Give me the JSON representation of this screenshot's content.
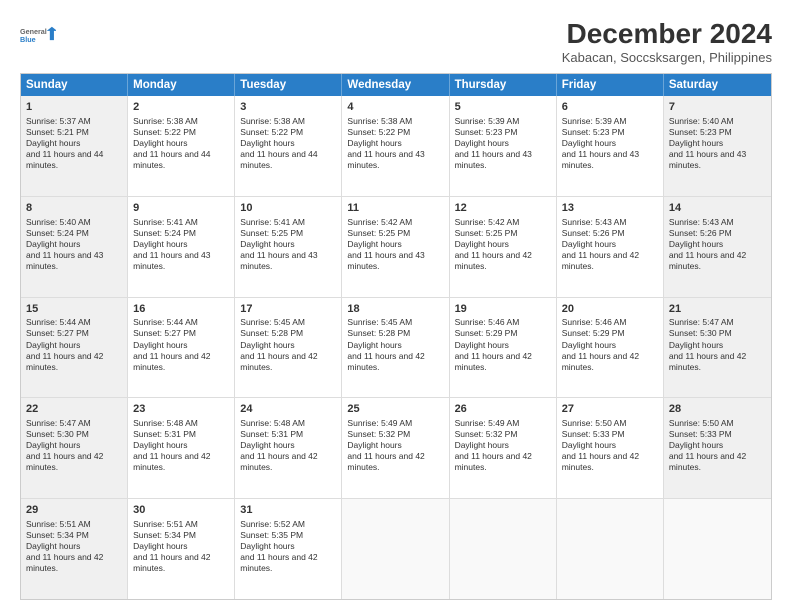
{
  "logo": {
    "line1": "General",
    "line2": "Blue"
  },
  "title": "December 2024",
  "subtitle": "Kabacan, Soccsksargen, Philippines",
  "header": {
    "days": [
      "Sunday",
      "Monday",
      "Tuesday",
      "Wednesday",
      "Thursday",
      "Friday",
      "Saturday"
    ]
  },
  "weeks": [
    {
      "cells": [
        {
          "day": "1",
          "rise": "5:37 AM",
          "set": "5:21 PM",
          "daylight": "11 hours and 44 minutes."
        },
        {
          "day": "2",
          "rise": "5:38 AM",
          "set": "5:22 PM",
          "daylight": "11 hours and 44 minutes."
        },
        {
          "day": "3",
          "rise": "5:38 AM",
          "set": "5:22 PM",
          "daylight": "11 hours and 44 minutes."
        },
        {
          "day": "4",
          "rise": "5:38 AM",
          "set": "5:22 PM",
          "daylight": "11 hours and 43 minutes."
        },
        {
          "day": "5",
          "rise": "5:39 AM",
          "set": "5:23 PM",
          "daylight": "11 hours and 43 minutes."
        },
        {
          "day": "6",
          "rise": "5:39 AM",
          "set": "5:23 PM",
          "daylight": "11 hours and 43 minutes."
        },
        {
          "day": "7",
          "rise": "5:40 AM",
          "set": "5:23 PM",
          "daylight": "11 hours and 43 minutes."
        }
      ]
    },
    {
      "cells": [
        {
          "day": "8",
          "rise": "5:40 AM",
          "set": "5:24 PM",
          "daylight": "11 hours and 43 minutes."
        },
        {
          "day": "9",
          "rise": "5:41 AM",
          "set": "5:24 PM",
          "daylight": "11 hours and 43 minutes."
        },
        {
          "day": "10",
          "rise": "5:41 AM",
          "set": "5:25 PM",
          "daylight": "11 hours and 43 minutes."
        },
        {
          "day": "11",
          "rise": "5:42 AM",
          "set": "5:25 PM",
          "daylight": "11 hours and 43 minutes."
        },
        {
          "day": "12",
          "rise": "5:42 AM",
          "set": "5:25 PM",
          "daylight": "11 hours and 42 minutes."
        },
        {
          "day": "13",
          "rise": "5:43 AM",
          "set": "5:26 PM",
          "daylight": "11 hours and 42 minutes."
        },
        {
          "day": "14",
          "rise": "5:43 AM",
          "set": "5:26 PM",
          "daylight": "11 hours and 42 minutes."
        }
      ]
    },
    {
      "cells": [
        {
          "day": "15",
          "rise": "5:44 AM",
          "set": "5:27 PM",
          "daylight": "11 hours and 42 minutes."
        },
        {
          "day": "16",
          "rise": "5:44 AM",
          "set": "5:27 PM",
          "daylight": "11 hours and 42 minutes."
        },
        {
          "day": "17",
          "rise": "5:45 AM",
          "set": "5:28 PM",
          "daylight": "11 hours and 42 minutes."
        },
        {
          "day": "18",
          "rise": "5:45 AM",
          "set": "5:28 PM",
          "daylight": "11 hours and 42 minutes."
        },
        {
          "day": "19",
          "rise": "5:46 AM",
          "set": "5:29 PM",
          "daylight": "11 hours and 42 minutes."
        },
        {
          "day": "20",
          "rise": "5:46 AM",
          "set": "5:29 PM",
          "daylight": "11 hours and 42 minutes."
        },
        {
          "day": "21",
          "rise": "5:47 AM",
          "set": "5:30 PM",
          "daylight": "11 hours and 42 minutes."
        }
      ]
    },
    {
      "cells": [
        {
          "day": "22",
          "rise": "5:47 AM",
          "set": "5:30 PM",
          "daylight": "11 hours and 42 minutes."
        },
        {
          "day": "23",
          "rise": "5:48 AM",
          "set": "5:31 PM",
          "daylight": "11 hours and 42 minutes."
        },
        {
          "day": "24",
          "rise": "5:48 AM",
          "set": "5:31 PM",
          "daylight": "11 hours and 42 minutes."
        },
        {
          "day": "25",
          "rise": "5:49 AM",
          "set": "5:32 PM",
          "daylight": "11 hours and 42 minutes."
        },
        {
          "day": "26",
          "rise": "5:49 AM",
          "set": "5:32 PM",
          "daylight": "11 hours and 42 minutes."
        },
        {
          "day": "27",
          "rise": "5:50 AM",
          "set": "5:33 PM",
          "daylight": "11 hours and 42 minutes."
        },
        {
          "day": "28",
          "rise": "5:50 AM",
          "set": "5:33 PM",
          "daylight": "11 hours and 42 minutes."
        }
      ]
    },
    {
      "cells": [
        {
          "day": "29",
          "rise": "5:51 AM",
          "set": "5:34 PM",
          "daylight": "11 hours and 42 minutes."
        },
        {
          "day": "30",
          "rise": "5:51 AM",
          "set": "5:34 PM",
          "daylight": "11 hours and 42 minutes."
        },
        {
          "day": "31",
          "rise": "5:52 AM",
          "set": "5:35 PM",
          "daylight": "11 hours and 42 minutes."
        },
        {
          "day": "",
          "rise": "",
          "set": "",
          "daylight": ""
        },
        {
          "day": "",
          "rise": "",
          "set": "",
          "daylight": ""
        },
        {
          "day": "",
          "rise": "",
          "set": "",
          "daylight": ""
        },
        {
          "day": "",
          "rise": "",
          "set": "",
          "daylight": ""
        }
      ]
    }
  ],
  "labels": {
    "sunrise": "Sunrise:",
    "sunset": "Sunset:",
    "daylight": "Daylight hours"
  }
}
